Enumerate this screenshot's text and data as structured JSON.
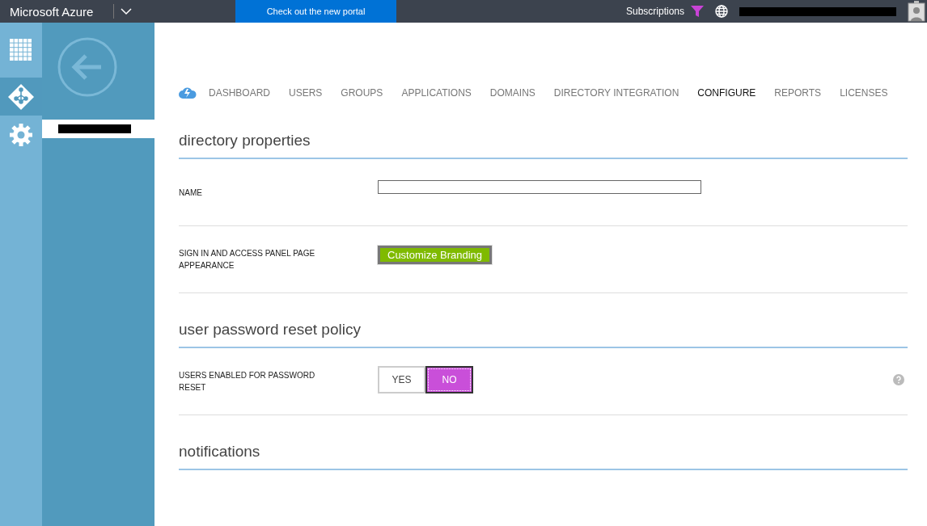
{
  "top_bar": {
    "brand": "Microsoft Azure",
    "promo": "Check out the new portal",
    "subscriptions": "Subscriptions"
  },
  "rail": [
    {
      "kind": "grid",
      "selected": false
    },
    {
      "kind": "directory",
      "selected": true
    },
    {
      "kind": "settings",
      "selected": false
    }
  ],
  "nav": [
    {
      "label": "DASHBOARD",
      "selected": false
    },
    {
      "label": "USERS",
      "selected": false
    },
    {
      "label": "GROUPS",
      "selected": false
    },
    {
      "label": "APPLICATIONS",
      "selected": false
    },
    {
      "label": "DOMAINS",
      "selected": false
    },
    {
      "label": "DIRECTORY INTEGRATION",
      "selected": false
    },
    {
      "label": "CONFIGURE",
      "selected": true
    },
    {
      "label": "REPORTS",
      "selected": false
    },
    {
      "label": "LICENSES",
      "selected": false
    }
  ],
  "sections": [
    {
      "title": "directory properties",
      "rows": [
        {
          "kind": "input",
          "label": "NAME"
        },
        {
          "kind": "button",
          "label": "SIGN IN AND ACCESS PANEL PAGE APPEARANCE",
          "button": "Customize Branding"
        }
      ]
    },
    {
      "title": "user password reset policy",
      "rows": [
        {
          "kind": "toggle",
          "label": "USERS ENABLED FOR PASSWORD RESET",
          "options": [
            {
              "label": "YES",
              "selected": false
            },
            {
              "label": "NO",
              "selected": true
            }
          ],
          "help": true
        }
      ]
    },
    {
      "title": "notifications"
    }
  ]
}
